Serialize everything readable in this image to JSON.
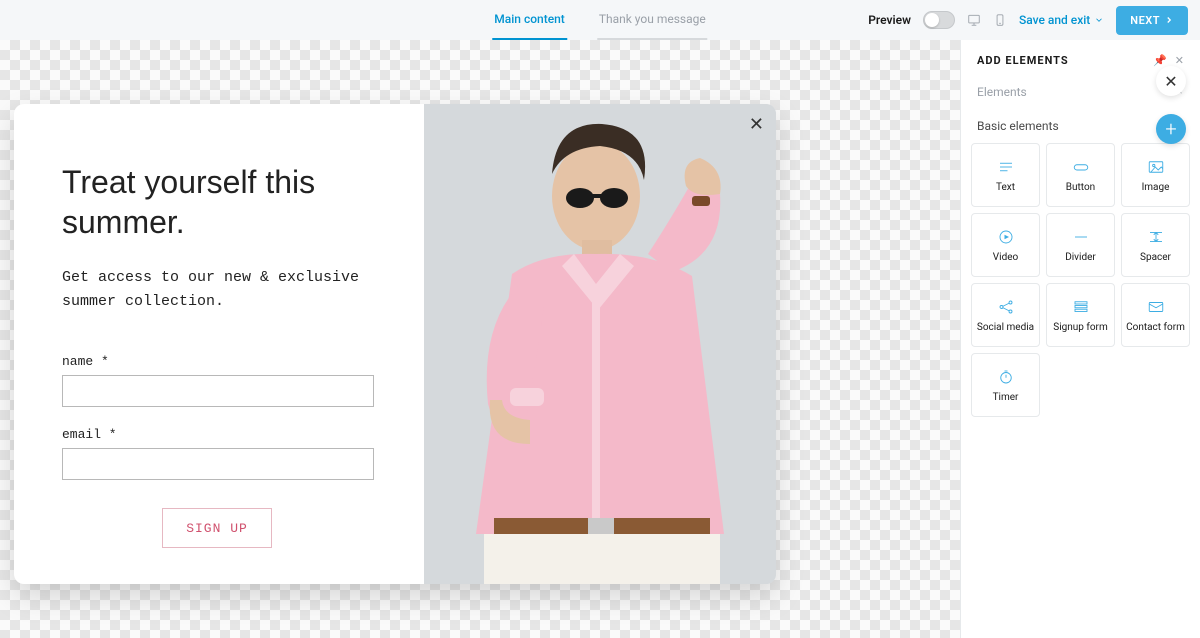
{
  "topbar": {
    "tab_main": "Main content",
    "tab_thankyou": "Thank you message",
    "preview": "Preview",
    "save_exit": "Save and exit",
    "next": "NEXT"
  },
  "popup": {
    "title": "Treat yourself this summer.",
    "desc": "Get access to our new & exclusive summer collection.",
    "name_label": "name *",
    "email_label": "email *",
    "signup": "SIGN UP"
  },
  "panel": {
    "title": "ADD ELEMENTS",
    "subhead": "Elements",
    "section": "Basic elements",
    "items": [
      "Text",
      "Button",
      "Image",
      "Video",
      "Divider",
      "Spacer",
      "Social media",
      "Signup form",
      "Contact form",
      "Timer"
    ]
  }
}
